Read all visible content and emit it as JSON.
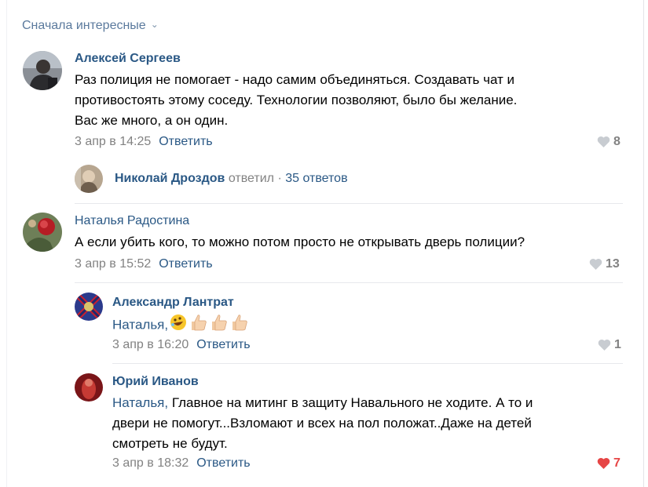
{
  "sort": {
    "label": "Сначала интересные"
  },
  "comments": [
    {
      "author": "Алексей Сергеев",
      "text": "Раз полиция не помогает - надо самим объединяться. Создавать чат и противостоять этому соседу. Технологии позволяют, было бы желание. Вас же много, а он один.",
      "lines": [
        "Раз полиция не помогает - надо самим объединяться. Создавать чат и",
        "противостоять этому соседу. Технологии позволяют, было бы желание.",
        "Вас же много, а он один."
      ],
      "date": "3 апр в 14:25",
      "reply_label": "Ответить",
      "likes": "8"
    },
    {
      "author": "Наталья Радостина",
      "text": "А если убить кого, то можно потом просто не открывать дверь полиции?",
      "date": "3 апр в 15:52",
      "reply_label": "Ответить",
      "likes": "13"
    }
  ],
  "thread_summary": {
    "name": "Николай Дроздов",
    "verb": "ответил",
    "separator": "·",
    "count": "35 ответов"
  },
  "replies": [
    {
      "author": "Александр Лантрат",
      "mention": "Наталья,",
      "emoji": [
        "rolling-laughing-emoji",
        "thumbs-up-emoji",
        "thumbs-up-emoji",
        "thumbs-up-emoji"
      ],
      "date": "3 апр в 16:20",
      "reply_label": "Ответить",
      "likes": "1"
    },
    {
      "author": "Юрий Иванов",
      "mention": "Наталья,",
      "lines": [
        " Главное на митинг в защиту Навального не ходите. А то и",
        "двери не помогут...Взломают и всех на пол положат..Даже на детей",
        "смотреть не будут."
      ],
      "date": "3 апр в 18:32",
      "reply_label": "Ответить",
      "likes": "7",
      "liked": true
    }
  ],
  "colors": {
    "link": "#2a5885",
    "muted": "#828282",
    "liked": "#e64646",
    "sort": "#5b7a9d"
  }
}
